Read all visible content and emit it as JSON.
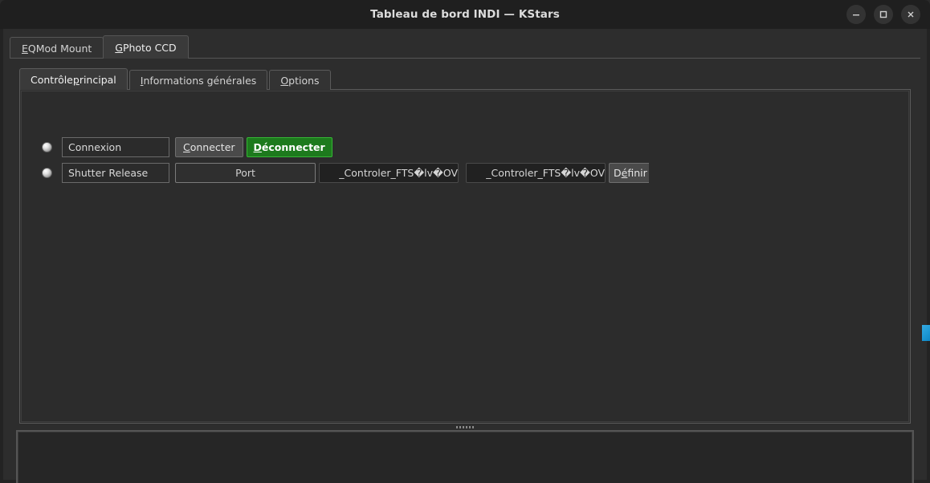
{
  "window": {
    "title": "Tableau de bord INDI — KStars",
    "controls": [
      {
        "name": "minimize",
        "glyph": "minimize-icon"
      },
      {
        "name": "maximize",
        "glyph": "maximize-icon"
      },
      {
        "name": "close",
        "glyph": "close-icon"
      }
    ]
  },
  "device_tabs": [
    {
      "label": "EQMod Mount",
      "accel": "E",
      "rest": "QMod Mount",
      "selected": false
    },
    {
      "label": "GPhoto CCD",
      "accel": "G",
      "rest": "Photo CCD",
      "selected": true
    }
  ],
  "property_tabs": [
    {
      "label": "Contrôle principal",
      "pre": "Contrôle ",
      "accel": "p",
      "rest": "rincipal",
      "selected": true
    },
    {
      "label": "Informations générales",
      "pre": "",
      "accel": "I",
      "rest": "nformations générales",
      "selected": false
    },
    {
      "label": "Options",
      "pre": "",
      "accel": "O",
      "rest": "ptions",
      "selected": false
    }
  ],
  "properties": [
    {
      "led_state": "idle",
      "name": "Connexion",
      "buttons": [
        {
          "label": "Connecter",
          "accel": "C",
          "rest": "onnecter",
          "style": "normal"
        },
        {
          "label": "Déconnecter",
          "accel": "D",
          "rest": "éconnecter",
          "style": "green"
        }
      ]
    },
    {
      "led_state": "idle",
      "name": "Shutter Release",
      "port_label": "Port",
      "fields": [
        {
          "value": "_Controler_FTS�lv�OV"
        },
        {
          "value": "_Controler_FTS�lv�OV"
        }
      ],
      "set_button": {
        "label": "Définir",
        "accel": "é",
        "pre": "D",
        "rest": "finir"
      }
    }
  ],
  "log": {
    "content": ""
  },
  "colors": {
    "accent_green": "#1d7a1d",
    "accent_blue": "#1f9ad6",
    "window_bg": "#2d2d2d",
    "titlebar_bg": "#1f1f1f",
    "panel_bg": "#2c2c2c"
  }
}
